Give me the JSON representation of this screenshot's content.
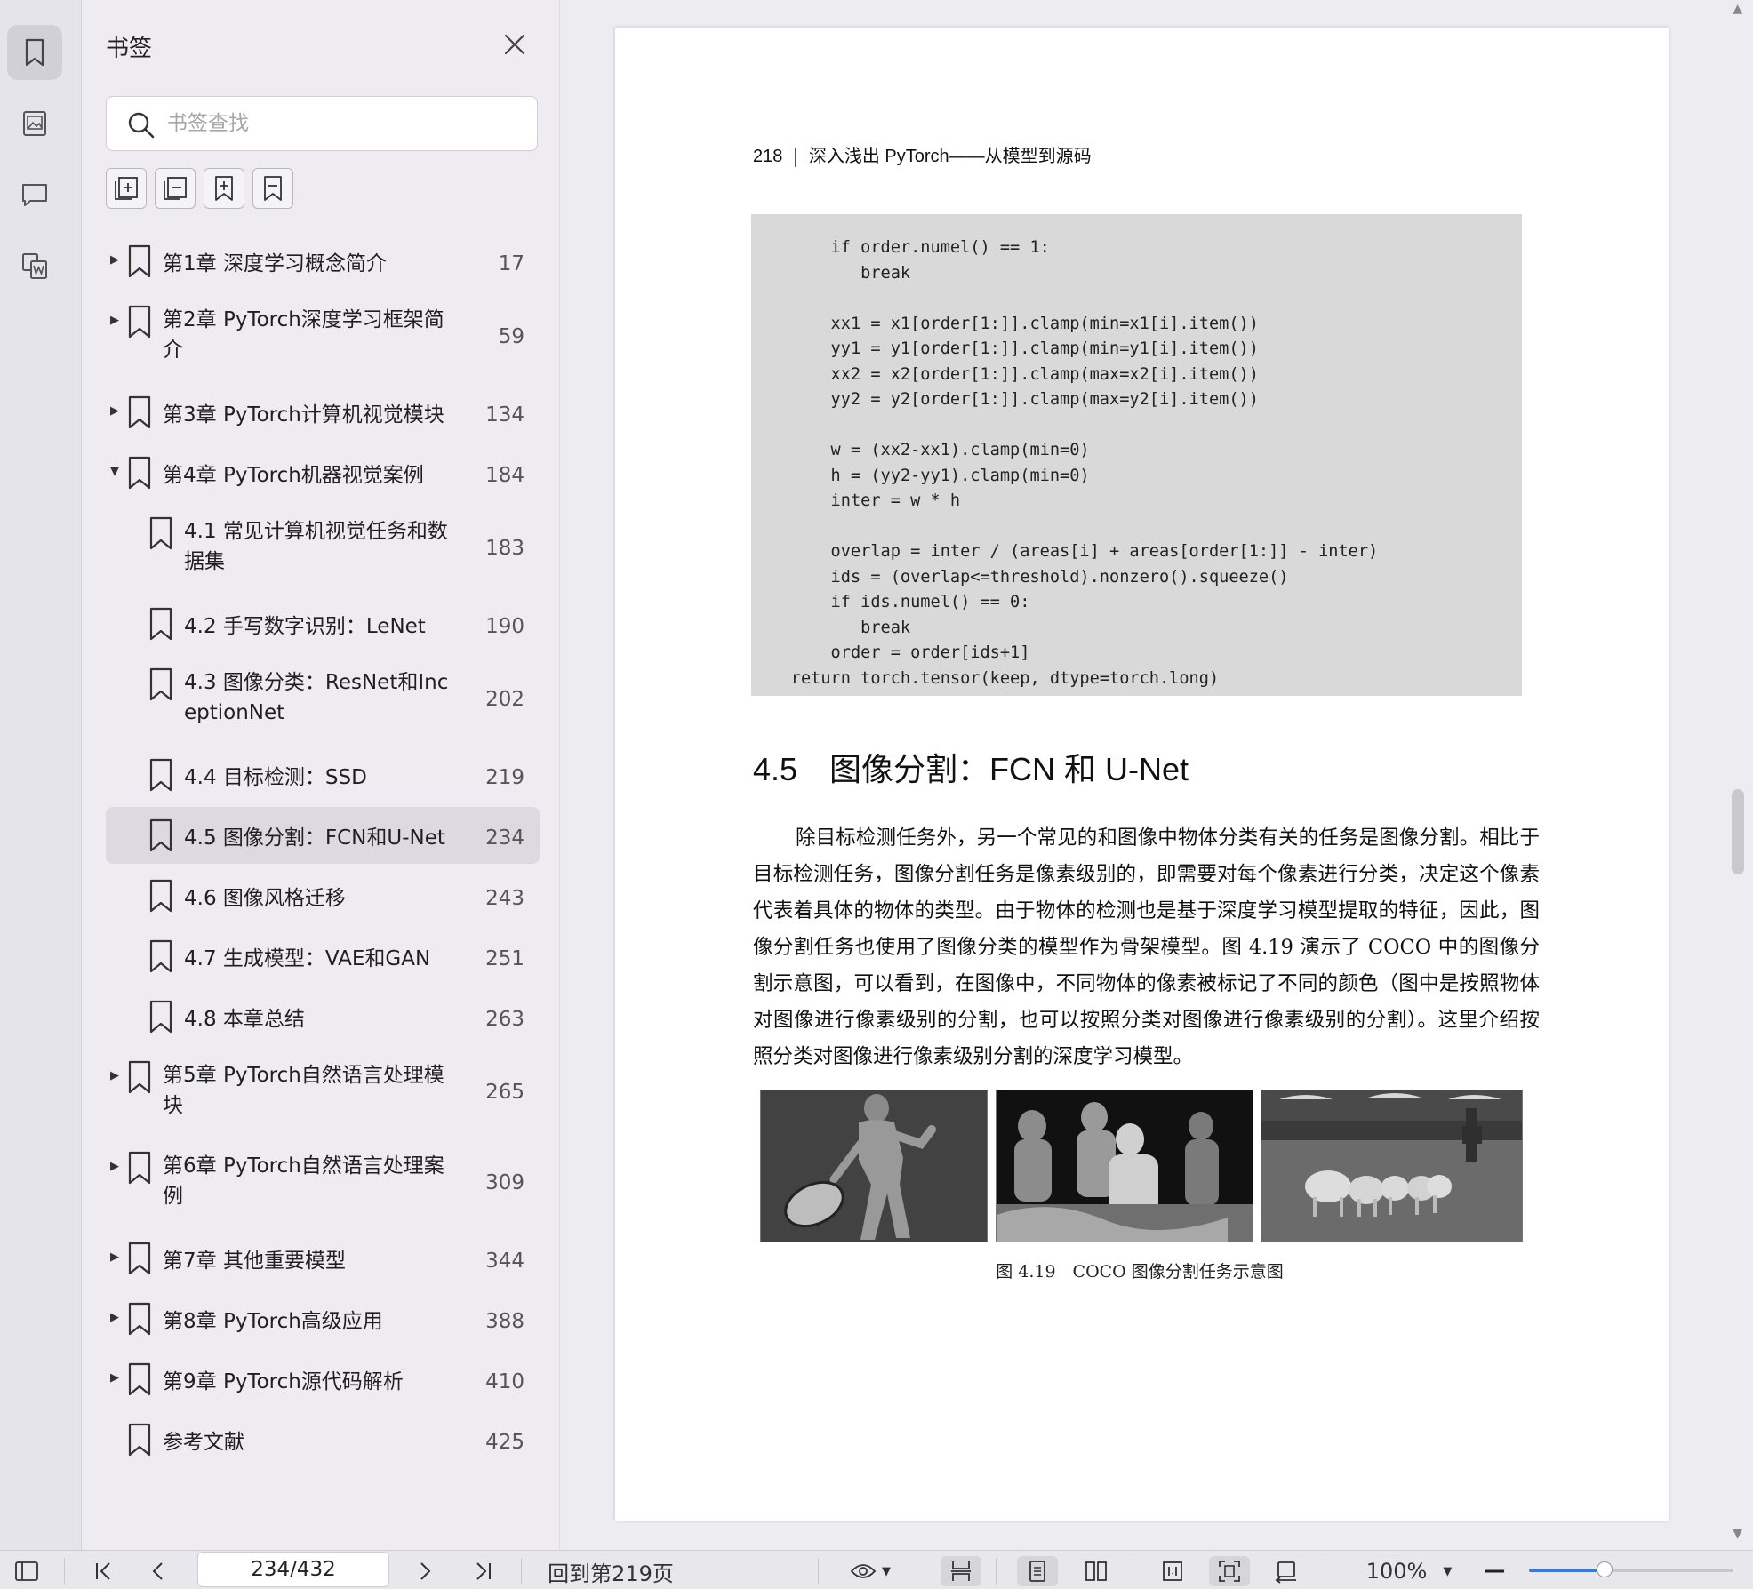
{
  "colors": {
    "rail_bg": "#e6e4eb",
    "panel_bg": "#eeecf0",
    "selected_row": "#dcdae0",
    "accent": "#3a7bd5",
    "code_bg": "#d9d9d9"
  },
  "rail": {
    "items": [
      {
        "name": "bookmark-icon",
        "active": true
      },
      {
        "name": "image-icon",
        "active": false
      },
      {
        "name": "comment-icon",
        "active": false
      },
      {
        "name": "document-convert-icon",
        "active": false
      }
    ]
  },
  "panel": {
    "title": "书签",
    "search_placeholder": "书签查找",
    "toolbar": [
      "expand-all-icon",
      "collapse-all-icon",
      "add-bookmark-icon",
      "remove-bookmark-icon"
    ],
    "bookmarks": [
      {
        "label": "第1章 深度学习概念简介",
        "page": "17",
        "level": 0,
        "expand": "collapsed"
      },
      {
        "label": "第2章 PyTorch深度学习框架简\n介",
        "page": "59",
        "level": 0,
        "expand": "collapsed",
        "tall": true
      },
      {
        "label": "第3章 PyTorch计算机视觉模块",
        "page": "134",
        "level": 0,
        "expand": "collapsed"
      },
      {
        "label": "第4章 PyTorch机器视觉案例",
        "page": "184",
        "level": 0,
        "expand": "expanded"
      },
      {
        "label": "4.1 常见计算机视觉任务和数\n据集",
        "page": "183",
        "level": 1,
        "tall": true
      },
      {
        "label": "4.2 手写数字识别：LeNet",
        "page": "190",
        "level": 1
      },
      {
        "label": "4.3 图像分类：ResNet和Inc\neptionNet",
        "page": "202",
        "level": 1,
        "tall": true
      },
      {
        "label": "4.4 目标检测：SSD",
        "page": "219",
        "level": 1
      },
      {
        "label": "4.5 图像分割：FCN和U-Net",
        "page": "234",
        "level": 1,
        "selected": true
      },
      {
        "label": "4.6 图像风格迁移",
        "page": "243",
        "level": 1
      },
      {
        "label": "4.7 生成模型：VAE和GAN",
        "page": "251",
        "level": 1
      },
      {
        "label": "4.8 本章总结",
        "page": "263",
        "level": 1
      },
      {
        "label": "第5章 PyTorch自然语言处理模\n块",
        "page": "265",
        "level": 0,
        "expand": "collapsed",
        "tall": true
      },
      {
        "label": "第6章 PyTorch自然语言处理案\n例",
        "page": "309",
        "level": 0,
        "expand": "collapsed",
        "tall": true
      },
      {
        "label": "第7章 其他重要模型",
        "page": "344",
        "level": 0,
        "expand": "collapsed"
      },
      {
        "label": "第8章 PyTorch高级应用",
        "page": "388",
        "level": 0,
        "expand": "collapsed"
      },
      {
        "label": "第9章 PyTorch源代码解析",
        "page": "410",
        "level": 0,
        "expand": "collapsed"
      },
      {
        "label": "参考文献",
        "page": "425",
        "level": 0,
        "expand": "none"
      }
    ]
  },
  "document": {
    "page_number": "218",
    "running_title": "深入浅出 PyTorch——从模型到源码",
    "code": "        if order.numel() == 1:\n           break\n\n        xx1 = x1[order[1:]].clamp(min=x1[i].item())\n        yy1 = y1[order[1:]].clamp(min=y1[i].item())\n        xx2 = x2[order[1:]].clamp(max=x2[i].item())\n        yy2 = y2[order[1:]].clamp(max=y2[i].item())\n\n        w = (xx2-xx1).clamp(min=0)\n        h = (yy2-yy1).clamp(min=0)\n        inter = w * h\n\n        overlap = inter / (areas[i] + areas[order[1:]] - inter)\n        ids = (overlap<=threshold).nonzero().squeeze()\n        if ids.numel() == 0:\n           break\n        order = order[ids+1]\n    return torch.tensor(keep, dtype=torch.long)",
    "section_number": "4.5",
    "section_title": "图像分割：FCN 和 U-Net",
    "body": "除目标检测任务外，另一个常见的和图像中物体分类有关的任务是图像分割。相比于目标检测任务，图像分割任务是像素级别的，即需要对每个像素进行分类，决定这个像素代表着具体的物体的类型。由于物体的检测也是基于深度学习模型提取的特征，因此，图像分割任务也使用了图像分类的模型作为骨架模型。图 4.19 演示了 COCO 中的图像分割示意图，可以看到，在图像中，不同物体的像素被标记了不同的颜色（图中是按照物体对图像进行像素级别的分割，也可以按照分类对图像进行像素级别的分割）。这里介绍按照分类对图像进行像素级别分割的深度学习模型。",
    "figure_caption": "图 4.19　COCO 图像分割任务示意图"
  },
  "statusbar": {
    "page_input": "234/432",
    "goto_label": "回到第219页",
    "zoom": "100%",
    "zoom_level": 0.37
  }
}
